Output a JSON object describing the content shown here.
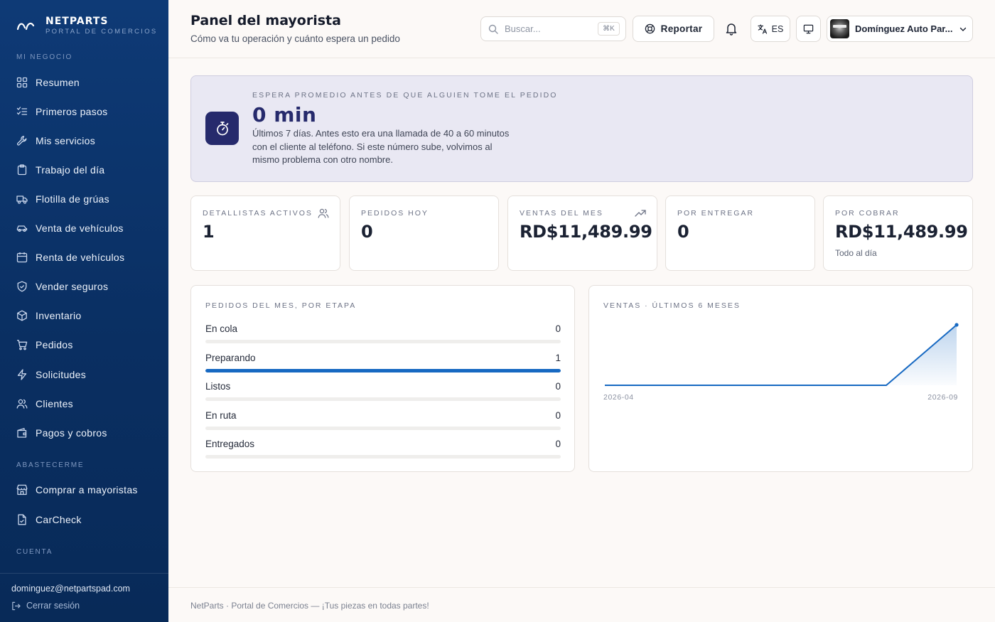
{
  "brand": {
    "name": "NETPARTS",
    "subtitle": "PORTAL DE COMERCIOS"
  },
  "sidebar": {
    "sections": [
      {
        "label": "MI NEGOCIO"
      },
      {
        "label": "ABASTECERME"
      },
      {
        "label": "CUENTA"
      }
    ],
    "items": [
      {
        "label": "Resumen",
        "icon": "grid-icon"
      },
      {
        "label": "Primeros pasos",
        "icon": "checklist-icon"
      },
      {
        "label": "Mis servicios",
        "icon": "wrench-icon"
      },
      {
        "label": "Trabajo del día",
        "icon": "clipboard-icon"
      },
      {
        "label": "Flotilla de grúas",
        "icon": "truck-icon"
      },
      {
        "label": "Venta de vehículos",
        "icon": "car-icon"
      },
      {
        "label": "Renta de vehículos",
        "icon": "calendar-icon"
      },
      {
        "label": "Vender seguros",
        "icon": "shield-icon"
      },
      {
        "label": "Inventario",
        "icon": "box-icon"
      },
      {
        "label": "Pedidos",
        "icon": "cart-icon"
      },
      {
        "label": "Solicitudes",
        "icon": "bolt-icon"
      },
      {
        "label": "Clientes",
        "icon": "users-icon"
      },
      {
        "label": "Pagos y cobros",
        "icon": "wallet-icon"
      },
      {
        "label": "Comprar a mayoristas",
        "icon": "store-icon"
      },
      {
        "label": "CarCheck",
        "icon": "file-check-icon"
      }
    ],
    "user_email": "dominguez@netpartspad.com",
    "logout_label": "Cerrar sesión"
  },
  "header": {
    "title": "Panel del mayorista",
    "subtitle": "Cómo va tu operación y cuánto espera un pedido",
    "search_placeholder": "Buscar...",
    "search_shortcut": "⌘K",
    "report_label": "Reportar",
    "language": "ES",
    "account_name": "Domínguez Auto Par..."
  },
  "hero": {
    "label": "ESPERA PROMEDIO ANTES DE QUE ALGUIEN TOME EL PEDIDO",
    "value": "0 min",
    "description": "Últimos 7 días. Antes esto era una llamada de 40 a 60 minutos con el cliente al teléfono. Si este número sube, volvimos al mismo problema con otro nombre."
  },
  "stats": [
    {
      "label": "DETALLISTAS ACTIVOS",
      "value": "1",
      "note": "",
      "icon": "users-icon"
    },
    {
      "label": "PEDIDOS HOY",
      "value": "0",
      "note": "",
      "icon": ""
    },
    {
      "label": "VENTAS DEL MES",
      "value": "RD$11,489.99",
      "note": "",
      "icon": "trending-up-icon"
    },
    {
      "label": "POR ENTREGAR",
      "value": "0",
      "note": "",
      "icon": ""
    },
    {
      "label": "POR COBRAR",
      "value": "RD$11,489.99",
      "note": "Todo al día",
      "icon": ""
    }
  ],
  "stages": {
    "title": "PEDIDOS DEL MES, POR ETAPA",
    "rows": [
      {
        "label": "En cola",
        "count": "0",
        "fraction": 0
      },
      {
        "label": "Preparando",
        "count": "1",
        "fraction": 1
      },
      {
        "label": "Listos",
        "count": "0",
        "fraction": 0
      },
      {
        "label": "En ruta",
        "count": "0",
        "fraction": 0
      },
      {
        "label": "Entregados",
        "count": "0",
        "fraction": 0
      }
    ]
  },
  "chart_data": {
    "type": "area",
    "title": "VENTAS · ÚLTIMOS 6 MESES",
    "x": [
      "2026-04",
      "2026-05",
      "2026-06",
      "2026-07",
      "2026-08",
      "2026-09"
    ],
    "tick_labels": [
      "2026-04",
      "2026-09"
    ],
    "values": [
      0,
      0,
      0,
      0,
      0,
      11489.99
    ],
    "ylim": [
      0,
      11489.99
    ],
    "grid": false,
    "line_color": "#1769c2"
  },
  "footer": {
    "text": "NetParts · Portal de Comercios — ¡Tus piezas en todas partes!"
  },
  "colors": {
    "sidebar": "#0e3a76",
    "accent": "#1769c2",
    "hero_icon": "#262a6c",
    "hero_bg": "#e9e8f3"
  }
}
